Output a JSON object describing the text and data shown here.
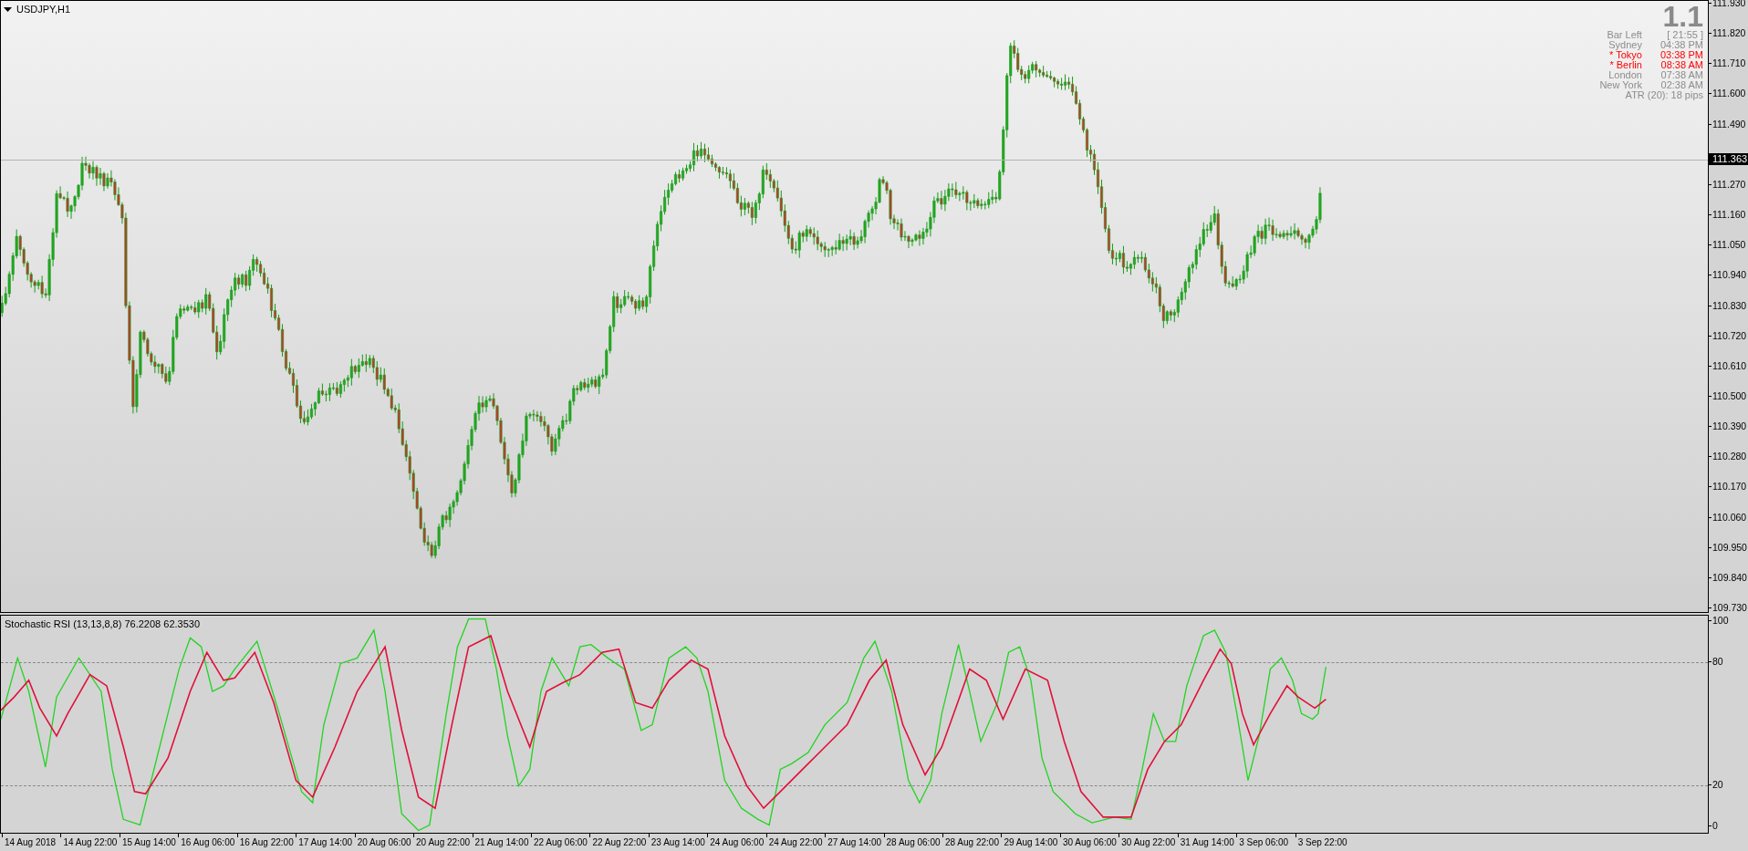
{
  "chart_title": "USDJPY,H1",
  "info_panel": {
    "headline": "1.1",
    "rows": [
      {
        "label": "Bar Left",
        "value": "[ 21:55 ]",
        "color": "#8c8c8c"
      },
      {
        "label": "Sydney",
        "value": "04:38 PM",
        "color": "#8c8c8c"
      },
      {
        "label": "* Tokyo",
        "value": "03:38 PM",
        "color": "#ff0000"
      },
      {
        "label": "* Berlin",
        "value": "08:38 AM",
        "color": "#ff0000"
      },
      {
        "label": "London",
        "value": "07:38 AM",
        "color": "#8c8c8c"
      },
      {
        "label": "New York",
        "value": "02:38 AM",
        "color": "#8c8c8c"
      }
    ],
    "atr": "ATR (20): 18 pips"
  },
  "price_axis": {
    "ticks": [
      "111.930",
      "111.820",
      "111.710",
      "111.600",
      "111.490",
      "111.270",
      "111.160",
      "111.050",
      "110.940",
      "110.830",
      "110.720",
      "110.610",
      "110.500",
      "110.390",
      "110.280",
      "110.170",
      "110.060",
      "109.950",
      "109.840",
      "109.730"
    ],
    "current_price": "111.363"
  },
  "indicator": {
    "title": "Stochastic RSI (13,13,8,8) 76.2208 62.3530",
    "axis_ticks": [
      "100",
      "80",
      "20",
      "0"
    ]
  },
  "time_axis": {
    "labels": [
      "14 Aug 2018",
      "14 Aug 22:00",
      "15 Aug 14:00",
      "16 Aug 06:00",
      "16 Aug 22:00",
      "17 Aug 14:00",
      "20 Aug 06:00",
      "20 Aug 22:00",
      "21 Aug 14:00",
      "22 Aug 06:00",
      "22 Aug 22:00",
      "23 Aug 14:00",
      "24 Aug 06:00",
      "24 Aug 22:00",
      "27 Aug 14:00",
      "28 Aug 06:00",
      "28 Aug 22:00",
      "29 Aug 14:00",
      "30 Aug 06:00",
      "30 Aug 22:00",
      "31 Aug 14:00",
      "3 Sep 06:00",
      "3 Sep 22:00"
    ]
  }
}
